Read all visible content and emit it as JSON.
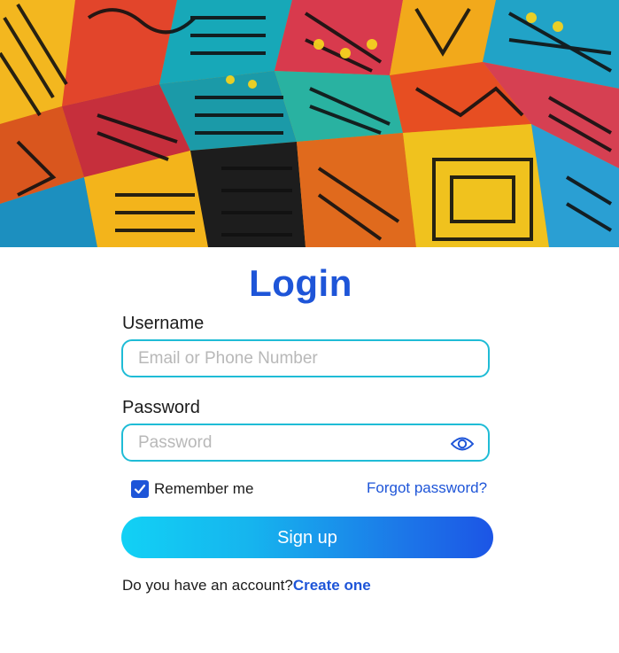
{
  "header": {
    "title": "Login"
  },
  "form": {
    "username_label": "Username",
    "username_placeholder": "Email or Phone Number",
    "password_label": "Password",
    "password_placeholder": "Password",
    "password_toggle_icon": "eye-icon",
    "remember_label": "Remember me",
    "remember_checked": true,
    "forgot_label": "Forgot password?",
    "submit_label": "Sign up"
  },
  "footer": {
    "prompt": "Do you have an account?",
    "link_label": "Create one"
  },
  "colors": {
    "accent": "#1e55d8",
    "field_border": "#1fbcd6",
    "button_gradient_start": "#12d1f5",
    "button_gradient_end": "#1c55e6"
  }
}
